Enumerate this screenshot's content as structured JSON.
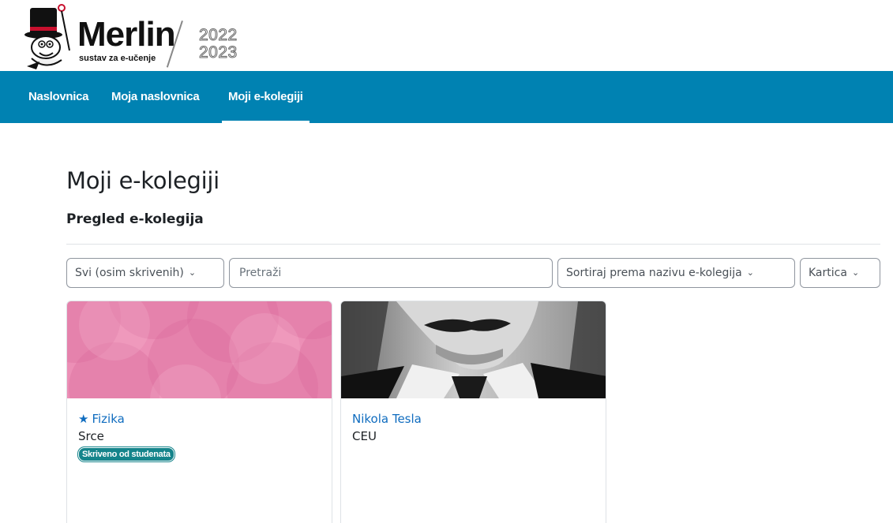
{
  "header": {
    "logo_brand": "Merlin",
    "logo_tagline": "sustav za e-učenje",
    "logo_year_top": "2022",
    "logo_year_bottom": "2023"
  },
  "nav": {
    "items": [
      {
        "label": "Naslovnica",
        "active": false
      },
      {
        "label": "Moja naslovnica",
        "active": false
      },
      {
        "label": "Moji e-kolegiji",
        "active": true
      }
    ]
  },
  "main": {
    "title": "Moji e-kolegiji",
    "subtitle": "Pregled e-kolegija"
  },
  "filters": {
    "grouping_selected": "Svi (osim skrivenih)",
    "search_placeholder": "Pretraži",
    "search_value": "",
    "sort_selected": "Sortiraj prema nazivu e-kolegija",
    "view_selected": "Kartica"
  },
  "courses": [
    {
      "name": "Fizika",
      "category": "Srce",
      "starred": true,
      "badge": "Skriveno od studenata",
      "image": "pink-circles-pattern"
    },
    {
      "name": "Nikola Tesla",
      "category": "CEU",
      "starred": false,
      "badge": "",
      "image": "nikola-tesla-portrait"
    }
  ],
  "colors": {
    "navbar": "#0082b2",
    "link": "#0f6cbf",
    "badge": "#15848b",
    "card_pattern": "#e989b1"
  }
}
